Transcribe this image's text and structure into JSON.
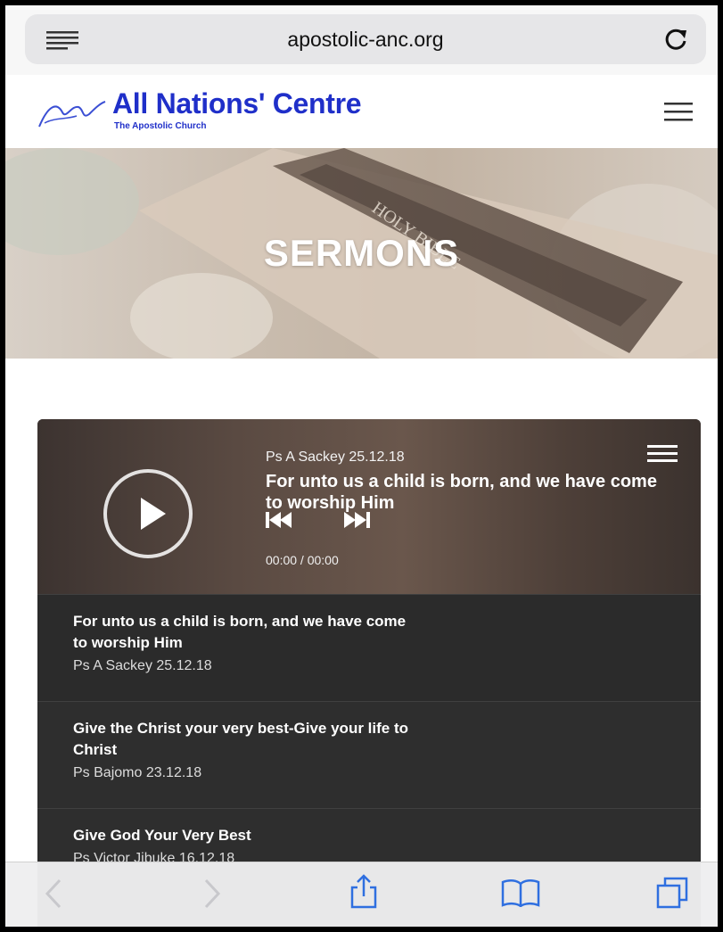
{
  "browser": {
    "url": "apostolic-anc.org"
  },
  "site": {
    "brand": "All Nations' Centre",
    "subtitle": "The Apostolic Church",
    "accent": "#1f2fc9"
  },
  "hero": {
    "title": "SERMONS"
  },
  "player": {
    "now_playing": {
      "speaker_date": "Ps A Sackey 25.12.18",
      "title": "For unto us a child is born, and we have come to worship Him",
      "time": "00:00 / 00:00"
    },
    "tracks": [
      {
        "title": "For unto us a child is born, and we have come to worship Him",
        "meta": "Ps A Sackey 25.12.18"
      },
      {
        "title": "Give the Christ your very best-Give your life to Christ",
        "meta": "Ps Bajomo 23.12.18"
      },
      {
        "title": "Give God Your Very Best",
        "meta": "Ps Victor Jibuke 16.12.18"
      }
    ]
  },
  "icons": {
    "url_menu": "lines-icon",
    "reload": "reload-icon",
    "site_menu": "hamburger-icon",
    "play": "play-icon",
    "prev": "skip-back-icon",
    "next": "skip-forward-icon",
    "playlist": "playlist-icon",
    "back": "back-arrow-icon",
    "forward": "forward-arrow-icon",
    "share": "share-icon",
    "bookmarks": "book-icon",
    "tabs": "tabs-icon"
  }
}
